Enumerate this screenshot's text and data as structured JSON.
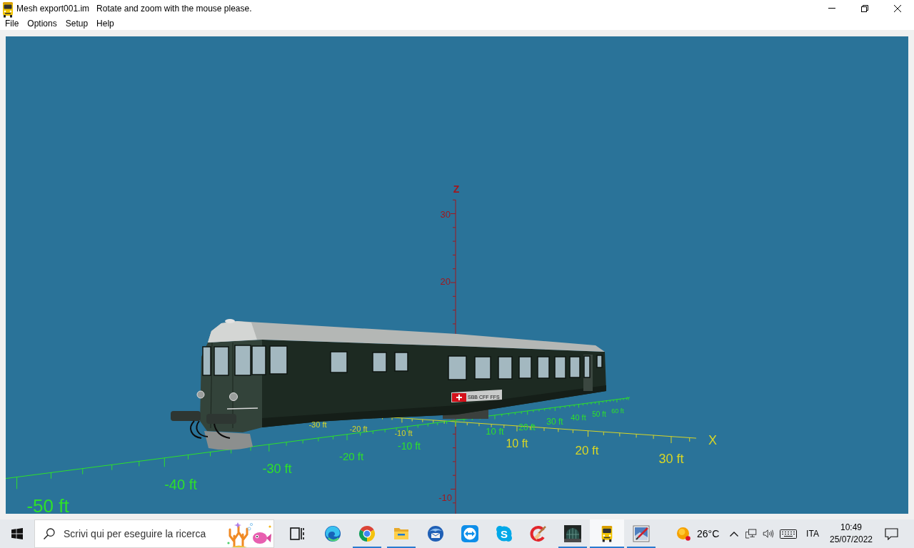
{
  "window": {
    "title": "Mesh export001.im",
    "hint": "Rotate and zoom with the mouse please."
  },
  "menu": [
    "File",
    "Options",
    "Setup",
    "Help"
  ],
  "viewport": {
    "axes": [
      {
        "kind": "z",
        "name": "Z",
        "labels": [
          "30",
          "20",
          "-10"
        ]
      },
      {
        "kind": "x",
        "name": "X",
        "labels": [
          "-30 ft",
          "-20 ft",
          "-10 ft",
          "10 ft",
          "20 ft",
          "30 ft"
        ]
      },
      {
        "kind": "y",
        "name": "Y",
        "labels": [
          "-50 ft",
          "-40 ft",
          "-30 ft",
          "-20 ft",
          "-10 ft",
          "10 ft",
          "20 ft",
          "30 ft",
          "40 ft",
          "50 ft",
          "60 ft"
        ]
      }
    ],
    "model": {
      "plate": "SBB CFF FFS"
    }
  },
  "taskbar": {
    "search": {
      "placeholder": "Scrivi qui per eseguire la ricerca"
    },
    "apps": [
      {
        "kind": "swirl",
        "running": false,
        "selected": false
      },
      {
        "kind": "ring",
        "running": true,
        "selected": false
      },
      {
        "kind": "folder",
        "running": true,
        "selected": false
      },
      {
        "kind": "globe",
        "running": false,
        "selected": false
      },
      {
        "kind": "arrows",
        "running": false,
        "selected": false
      },
      {
        "kind": "bubble",
        "glyph": "S",
        "running": false,
        "selected": false
      },
      {
        "kind": "brush",
        "running": false,
        "selected": false
      },
      {
        "kind": "dome",
        "running": true,
        "selected": false
      },
      {
        "kind": "bus",
        "running": true,
        "selected": true
      },
      {
        "kind": "picture",
        "running": true,
        "selected": false
      }
    ],
    "weather": {
      "temperature": "26°C"
    },
    "language": "ITA",
    "clock": {
      "time": "10:49",
      "date": "25/07/2022"
    }
  }
}
